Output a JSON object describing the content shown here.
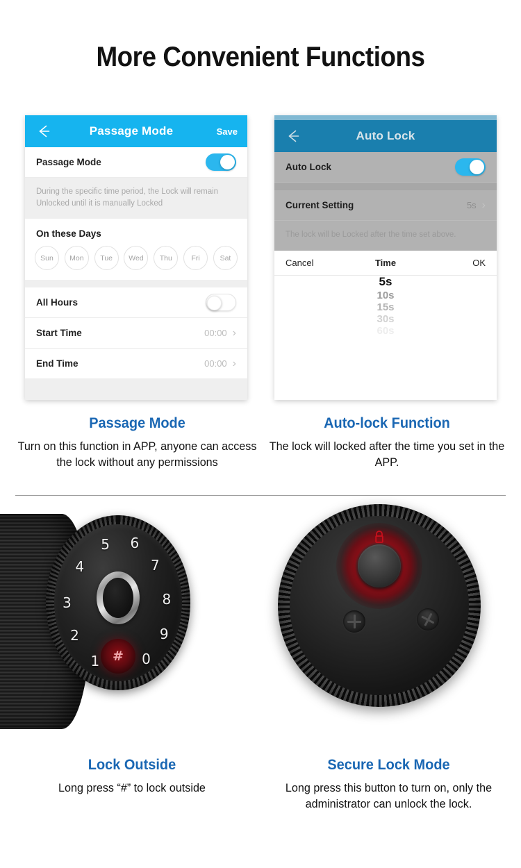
{
  "page": {
    "title": "More Convenient Functions"
  },
  "passage_screen": {
    "back_icon": "back-arrow-icon",
    "title": "Passage Mode",
    "save_label": "Save",
    "toggle_row_label": "Passage Mode",
    "toggle_state": "on",
    "note": "During the specific time period, the Lock will remain Unlocked until it is manually Locked",
    "days_section_title": "On these Days",
    "days": [
      "Sun",
      "Mon",
      "Tue",
      "Wed",
      "Thu",
      "Fri",
      "Sat"
    ],
    "all_hours_label": "All Hours",
    "all_hours_state": "off",
    "start_time_label": "Start Time",
    "start_time_value": "00:00",
    "end_time_label": "End Time",
    "end_time_value": "00:00",
    "chevron": "›"
  },
  "autolock_screen": {
    "back_icon": "back-arrow-icon",
    "title": "Auto Lock",
    "toggle_row_label": "Auto Lock",
    "toggle_state": "on",
    "current_setting_label": "Current Setting",
    "current_setting_value": "5s",
    "note": "The lock will be Locked after the time set above.",
    "chevron": "›",
    "picker": {
      "cancel_label": "Cancel",
      "title": "Time",
      "ok_label": "OK",
      "selected": "5s",
      "options": [
        "5s",
        "10s",
        "15s",
        "30s",
        "60s"
      ]
    }
  },
  "captions": {
    "passage": {
      "heading": "Passage Mode",
      "body": "Turn on this function in APP, anyone can access the lock without any permissions"
    },
    "autolock": {
      "heading": "Auto-lock Function",
      "body": "The lock will locked after the time you set in the APP."
    },
    "lock_outside": {
      "heading": "Lock Outside",
      "body": "Long press  “#”  to lock outside"
    },
    "secure_lock": {
      "heading": "Secure Lock Mode",
      "body": "Long press this button to turn on, only the administrator can unlock the lock."
    }
  },
  "keypad": {
    "digits": [
      "1",
      "2",
      "3",
      "4",
      "5",
      "6",
      "7",
      "8",
      "9",
      "0"
    ],
    "hash_key": "#"
  },
  "colors": {
    "header_blue": "#16B4EF",
    "header_blue_dim": "#1A7FAE",
    "toggle_on": "#2BB7EE",
    "caption_heading": "#1A67B3",
    "accent_red": "#8E0D14"
  }
}
